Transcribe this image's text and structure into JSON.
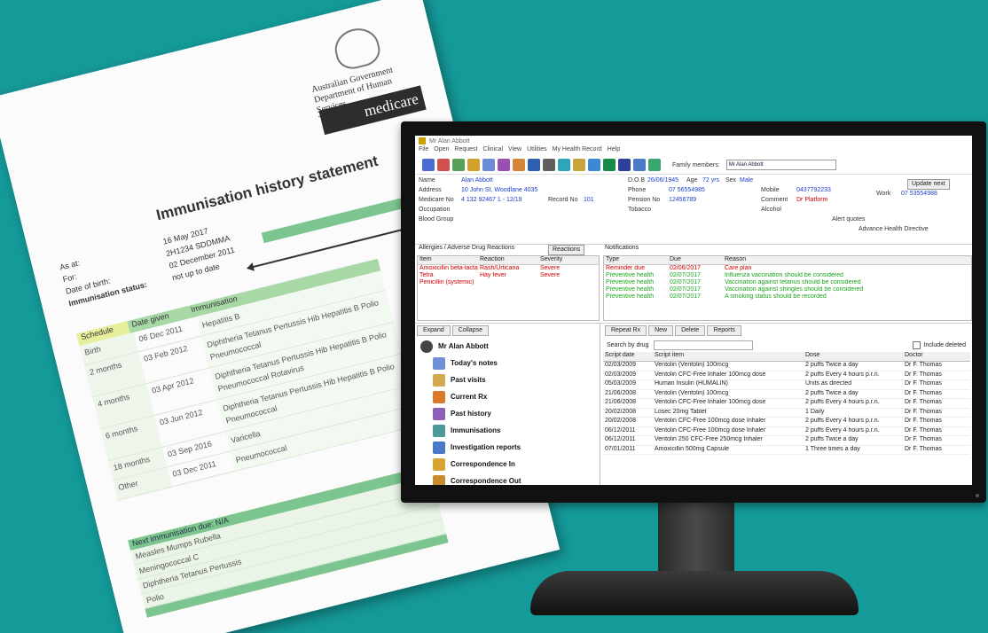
{
  "paper": {
    "agency_line1": "Australian Government",
    "agency_line2": "Department of Human Services",
    "brand": "medicare",
    "title": "Immunisation history statement",
    "fields": [
      {
        "label": "As at:",
        "value": "16 May 2017"
      },
      {
        "label": "For:",
        "value": "2H1234 SDDMMA"
      },
      {
        "label": "Date of birth:",
        "value": "02 December 2011"
      },
      {
        "label": "Immunisation status:",
        "value": "not up to date"
      }
    ],
    "table_headers": [
      "Schedule",
      "Date given",
      "Immunisation"
    ],
    "rows": [
      {
        "schedule": "Birth",
        "date": "06 Dec 2011",
        "vaccine": "Hepatitis B"
      },
      {
        "schedule": "2 months",
        "date": "03 Feb 2012",
        "vaccine": "Diphtheria Tetanus Pertussis Hib Hepatitis B Polio Pneumococcal"
      },
      {
        "schedule": "4 months",
        "date": "03 Apr 2012",
        "vaccine": "Diphtheria Tetanus Pertussis Hib Hepatitis B Polio Pneumococcal Rotavirus"
      },
      {
        "schedule": "6 months",
        "date": "03 Jun 2012",
        "vaccine": "Diphtheria Tetanus Pertussis Hib Hepatitis B Polio Pneumococcal"
      },
      {
        "schedule": "18 months",
        "date": "03 Sep 2016",
        "vaccine": "Varicella"
      },
      {
        "schedule": "Other",
        "date": "03 Dec 2011",
        "vaccine": "Pneumococcal"
      }
    ],
    "next_due_title": "Next immunisation due: N/A",
    "next_due_items": [
      "Measles Mumps Rubella",
      "Meningococcal C",
      "Diphtheria Tetanus Pertussis",
      "Polio"
    ]
  },
  "app": {
    "title": "Mr Alan Abbott",
    "menu": [
      "File",
      "Open",
      "Request",
      "Clinical",
      "View",
      "Utilities",
      "My Health Record",
      "Help"
    ],
    "family_label": "Family members:",
    "family_value": "Mr Alan Abbott",
    "patient": {
      "name_label": "Name",
      "name": "Alan Abbott",
      "address_label": "Address",
      "address": "10 John St, Woodlane 4035",
      "medicare_label": "Medicare No",
      "medicare": "4 132 92467 1 - 12/19",
      "record_label": "Record No",
      "record": "101",
      "occupation_label": "Occupation",
      "blood_label": "Blood Group",
      "dob_label": "D.O.B",
      "dob": "26/06/1945",
      "age_label": "Age",
      "age": "72 yrs",
      "sex_label": "Sex",
      "sex": "Male",
      "phone_label": "Phone",
      "phone": "07 56554985",
      "pension_label": "Pension No",
      "pension": "12456789",
      "tobacco_label": "Tobacco",
      "mobile_label": "Mobile",
      "mobile": "0437792233",
      "comment_label": "Comment",
      "comment": "Dr Platform",
      "alcohol_label": "Alcohol",
      "work_label": "Work",
      "work": "07 53554988",
      "update_btn": "Update next",
      "alert_label": "Alert quotes",
      "advance_label": "Advance Health Directive"
    },
    "allergies": {
      "title": "Allergies / Adverse Drug Reactions",
      "button": "Reactions",
      "headers": [
        "Item",
        "Reaction",
        "Severity"
      ],
      "rows": [
        [
          "Amoxicillin beta-lacta",
          "Rash/Urticaria",
          "Severe"
        ],
        [
          "Tetra",
          "Hay fever",
          "Severe"
        ],
        [
          "Penicillin (systemic)",
          "",
          ""
        ]
      ]
    },
    "notifications": {
      "title": "Notifications",
      "headers": [
        "Type",
        "Due",
        "Reason"
      ],
      "rows": [
        {
          "type": "Reminder due",
          "due": "02/06/2017",
          "reason": "Care plan",
          "color": "#d00000"
        },
        {
          "type": "Preventive health",
          "due": "02/07/2017",
          "reason": "Influenza vaccination should be considered",
          "color": "#1aa31a"
        },
        {
          "type": "Preventive health",
          "due": "02/07/2017",
          "reason": "Vaccination against tetanus should be considered",
          "color": "#1aa31a"
        },
        {
          "type": "Preventive health",
          "due": "02/07/2017",
          "reason": "Vaccination against shingles should be considered",
          "color": "#1aa31a"
        },
        {
          "type": "Preventive health",
          "due": "02/07/2017",
          "reason": "A smoking status should be recorded",
          "color": "#1aa31a"
        }
      ]
    },
    "tree_tabs": [
      "Expand",
      "Collapse"
    ],
    "tree": {
      "root": "Mr Alan Abbott",
      "items": [
        "Today's notes",
        "Past visits",
        "Current Rx",
        "Past history",
        "Immunisations",
        "Investigation reports",
        "Correspondence In",
        "Correspondence Out"
      ]
    },
    "rx_tabs": [
      "Repeat Rx",
      "New",
      "Delete",
      "Reports"
    ],
    "rx_search_label": "Search by drug",
    "rx_include_label": "Include deleted",
    "rx_headers": [
      "Script date",
      "Script item",
      "Dose",
      "Doctor"
    ],
    "rx_rows": [
      [
        "02/03/2009",
        "Ventolin (Ventolin) 100mcg",
        "2 puffs Twice a day",
        "Dr F. Thomas"
      ],
      [
        "02/03/2009",
        "Ventolin CFC-Free Inhaler 100mcg dose",
        "2 puffs Every 4 hours p.r.n.",
        "Dr F. Thomas"
      ],
      [
        "05/03/2009",
        "Human Insulin (HUMALIN)",
        "Units as directed",
        "Dr F. Thomas"
      ],
      [
        "21/06/2008",
        "Ventolin (Ventolin) 100mcg",
        "2 puffs Twice a day",
        "Dr F. Thomas"
      ],
      [
        "21/06/2008",
        "Ventolin CFC-Free Inhaler 100mcg dose",
        "2 puffs Every 4 hours p.r.n.",
        "Dr F. Thomas"
      ],
      [
        "20/02/2008",
        "Losec 20mg Tablet",
        "1 Daily",
        "Dr F. Thomas"
      ],
      [
        "20/02/2008",
        "Ventolin CFC-Free 100mcg dose Inhaler",
        "2 puffs Every 4 hours p.r.n.",
        "Dr F. Thomas"
      ],
      [
        "06/12/2011",
        "Ventolin CFC-Free 100mcg dose Inhaler",
        "2 puffs Every 4 hours p.r.n.",
        "Dr F. Thomas"
      ],
      [
        "06/12/2011",
        "Ventolin 250 CFC-Free 250mcg Inhaler",
        "2 puffs Twice a day",
        "Dr F. Thomas"
      ],
      [
        "07/01/2011",
        "Amoxicillin 500mg Capsule",
        "1 Three times a day",
        "Dr F. Thomas"
      ]
    ]
  },
  "colors": {
    "background": "#159a9a",
    "paper_green": "#7cc58f",
    "link_blue": "#1a3fc8"
  }
}
